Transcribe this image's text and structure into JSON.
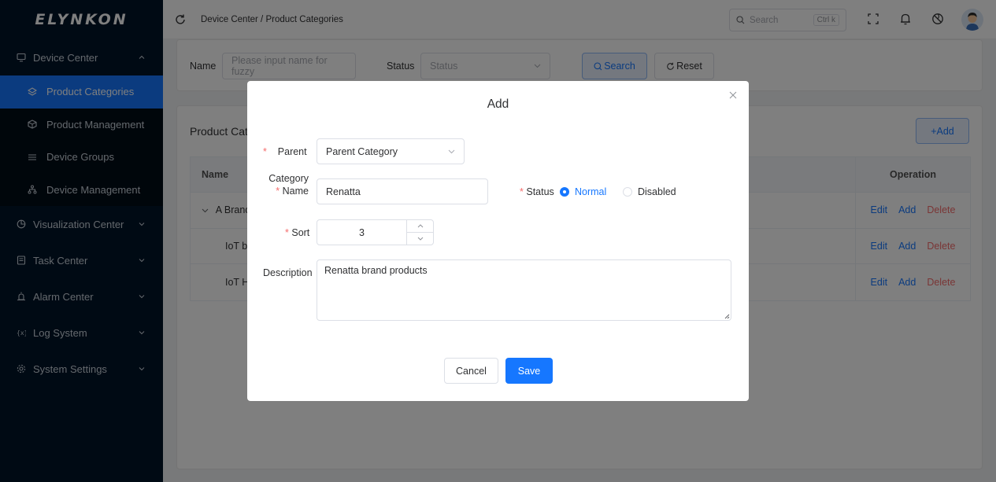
{
  "app": {
    "logo": "ELYNKON"
  },
  "sidebar": {
    "groups": [
      {
        "label": "Device Center",
        "icon": "monitor-icon",
        "expanded": true
      },
      {
        "label": "Visualization Center",
        "icon": "chart-icon"
      },
      {
        "label": "Task Center",
        "icon": "task-icon"
      },
      {
        "label": "Alarm Center",
        "icon": "alarm-icon"
      },
      {
        "label": "Log System",
        "icon": "log-icon"
      },
      {
        "label": "System Settings",
        "icon": "gear-icon"
      }
    ],
    "device_center_items": [
      {
        "label": "Product Categories",
        "icon": "layers-icon",
        "active": true
      },
      {
        "label": "Product Management",
        "icon": "box-icon"
      },
      {
        "label": "Device Groups",
        "icon": "list-icon"
      },
      {
        "label": "Device Management",
        "icon": "network-icon"
      }
    ]
  },
  "topbar": {
    "breadcrumb": "Device Center / Product Categories",
    "search_placeholder": "Search",
    "search_shortcut": "Ctrl k"
  },
  "filter": {
    "name_label": "Name",
    "name_placeholder": "Please input name for fuzzy",
    "status_label": "Status",
    "status_placeholder": "Status",
    "search_button": "Search",
    "reset_button": "Reset"
  },
  "table_card": {
    "title": "Product Cate",
    "add_button": "+Add",
    "columns": {
      "name": "Name",
      "operation": "Operation"
    },
    "rows": [
      {
        "name": "A Brand",
        "expandable": true
      },
      {
        "name": "IoT bo",
        "indent": true
      },
      {
        "name": "IoT HI",
        "indent": true
      }
    ],
    "actions": {
      "edit": "Edit",
      "add": "Add",
      "delete": "Delete"
    }
  },
  "modal": {
    "title": "Add",
    "parent_label": "Parent",
    "parent_value": "Parent Category",
    "category_label_line1": "Category",
    "category_label_line2": "Name",
    "category_value": "Renatta",
    "status_label": "Status",
    "status_options": [
      "Normal",
      "Disabled"
    ],
    "status_selected": "Normal",
    "sort_label": "Sort",
    "sort_value": "3",
    "description_label": "Description",
    "description_value": "Renatta brand products",
    "cancel_button": "Cancel",
    "save_button": "Save",
    "required_mark": "*"
  },
  "colors": {
    "primary": "#1677ff",
    "danger": "#f56c6c",
    "sidebar_bg": "#001529"
  }
}
